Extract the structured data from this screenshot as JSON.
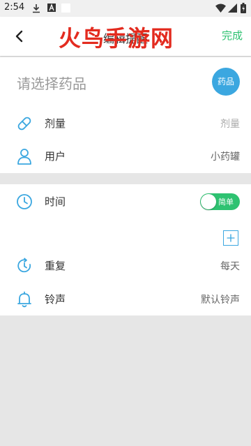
{
  "status_bar": {
    "time": "2:54"
  },
  "header": {
    "title": "编辑提醒",
    "watermark": "火鸟手游网",
    "done_label": "完成"
  },
  "medicine": {
    "placeholder": "请选择药品",
    "button_label": "药品"
  },
  "rows": {
    "dosage": {
      "label": "剂量",
      "value": "剂量"
    },
    "user": {
      "label": "用户",
      "value": "小药罐"
    },
    "time": {
      "label": "时间",
      "toggle_label": "简单",
      "toggle_on": true
    },
    "repeat": {
      "label": "重复",
      "value": "每天"
    },
    "ringtone": {
      "label": "铃声",
      "value": "默认铃声"
    }
  },
  "colors": {
    "accent_blue": "#3ba7e0",
    "accent_green": "#2ec271",
    "watermark_red": "#e32b1f"
  },
  "icons": [
    "download-icon",
    "font-icon",
    "wifi-icon",
    "signal-icon",
    "battery-icon",
    "back-arrow-icon",
    "pill-icon",
    "user-icon",
    "clock-icon",
    "repeat-icon",
    "bell-icon",
    "plus-icon"
  ]
}
